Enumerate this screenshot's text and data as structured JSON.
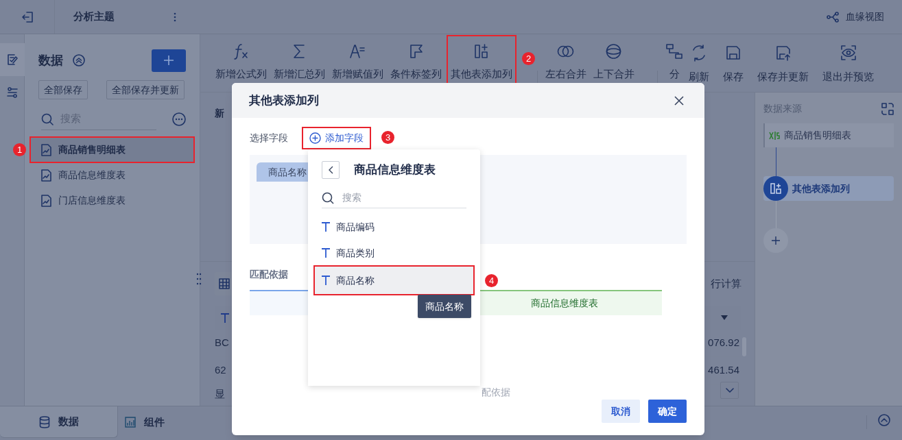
{
  "header": {
    "title": "分析主题",
    "lineage_label": "血缘视图"
  },
  "left_rail": [
    {
      "kind": "edit",
      "selected": true
    },
    {
      "kind": "flow",
      "selected": false
    }
  ],
  "data_panel": {
    "title": "数据",
    "buttons": [
      "全部保存",
      "全部保存并更新"
    ],
    "search": {
      "placeholder": "搜索"
    },
    "tables": [
      {
        "label": "商品销售明细表",
        "selected": true,
        "step": "1"
      },
      {
        "label": "商品信息维度表",
        "selected": false
      },
      {
        "label": "门店信息维度表",
        "selected": false
      }
    ]
  },
  "toolbar": {
    "tools": [
      {
        "kind": "formula",
        "label": "新增公式列"
      },
      {
        "kind": "sum",
        "label": "新增汇总列"
      },
      {
        "kind": "assign",
        "label": "新增赋值列"
      },
      {
        "kind": "flag",
        "label": "条件标签列"
      },
      {
        "kind": "addcol",
        "label": "其他表添加列",
        "step": "2"
      },
      {
        "kind": "join",
        "label": "左右合并",
        "separator_before": true
      },
      {
        "kind": "union",
        "label": "上下合并"
      },
      {
        "kind": "group",
        "label": "分",
        "separator_before": true
      }
    ],
    "actions": [
      {
        "kind": "refresh",
        "label": "刷新"
      },
      {
        "kind": "save",
        "label": "保存"
      },
      {
        "kind": "save_update",
        "label": "保存并更新"
      },
      {
        "kind": "preview",
        "label": "退出并预览"
      }
    ]
  },
  "workspace": {
    "heading": "新",
    "hint": "行计算",
    "rows": [
      [
        "BC",
        "076.92"
      ],
      [
        "62",
        "461.54"
      ]
    ],
    "footer": "显"
  },
  "data_source": {
    "title": "数据来源",
    "nodes": [
      {
        "kind": "source",
        "label": "商品销售明细表",
        "selected": false
      },
      {
        "kind": "step",
        "label": "其他表添加列",
        "selected": true
      }
    ]
  },
  "bottom_tabs": [
    {
      "kind": "database",
      "label": "数据",
      "selected": true
    },
    {
      "kind": "chart",
      "label": "组件",
      "selected": false
    }
  ],
  "dialog": {
    "title": "其他表添加列",
    "field_label": "选择字段",
    "add_field": {
      "label": "添加字段",
      "step": "3"
    },
    "chips": [
      "商品名称"
    ],
    "match_label": "匹配依据",
    "match_header": "商品信息维度表",
    "empty_text": "配依据",
    "buttons": [
      {
        "kind": "cancel",
        "label": "取消"
      },
      {
        "kind": "confirm",
        "label": "确定"
      }
    ]
  },
  "field_picker": {
    "title": "商品信息维度表",
    "search": {
      "placeholder": "搜索"
    },
    "fields": [
      {
        "label": "商品编码",
        "hovered": false
      },
      {
        "label": "商品类别",
        "hovered": false
      },
      {
        "label": "商品名称",
        "hovered": true,
        "step": "4"
      }
    ],
    "tooltip": "商品名称"
  }
}
